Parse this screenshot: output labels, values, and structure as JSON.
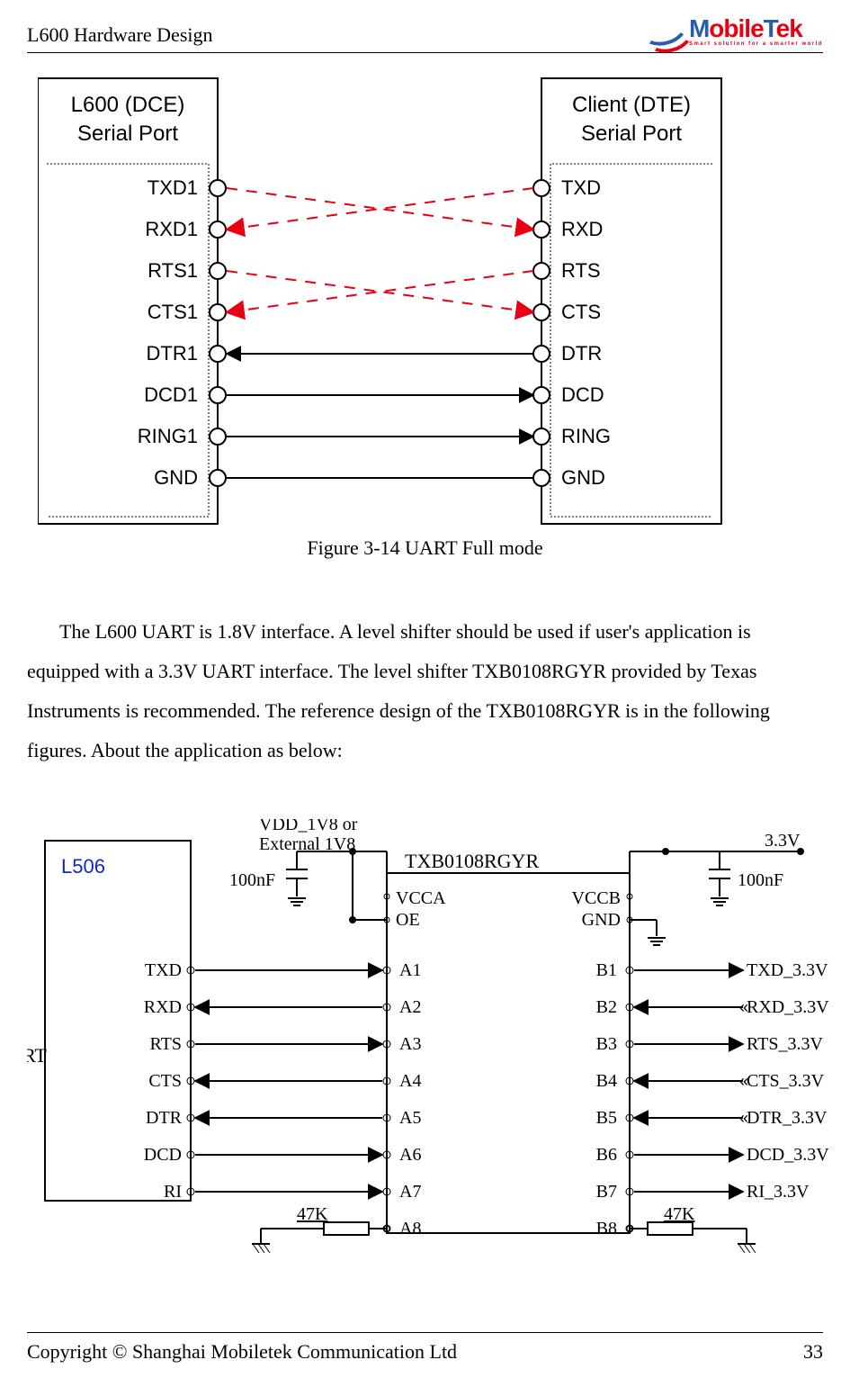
{
  "header": {
    "title": "L600 Hardware Design",
    "logo_main1": "M",
    "logo_main2": "obile",
    "logo_main3": "T",
    "logo_main4": "ek",
    "logo_tag": "Smart solution for a smarter world"
  },
  "footer": {
    "copyright": "Copyright  ©  Shanghai  Mobiletek  Communication  Ltd",
    "page": "33"
  },
  "figure": {
    "caption": "Figure 3-14 UART Full mode"
  },
  "body": {
    "p1": "The L600 UART is 1.8V interface. A level shifter should be used if user's application is equipped with a 3.3V UART interface. The level shifter TXB0108RGYR provided by Texas Instruments is recommended. The reference design of the TXB0108RGYR is in the following figures. About the application as below:"
  },
  "diagram": {
    "left_title": "L600 (DCE)",
    "left_sub": "Serial Port",
    "right_title": "Client (DTE)",
    "right_sub": "Serial Port",
    "left_pins": [
      "TXD1",
      "RXD1",
      "RTS1",
      "CTS1",
      "DTR1",
      "DCD1",
      "RING1",
      "GND"
    ],
    "right_pins": [
      "TXD",
      "RXD",
      "RTS",
      "CTS",
      "DTR",
      "DCD",
      "RING",
      "GND"
    ]
  },
  "image2": {
    "vdd": "VDD_1V8 or\nExternal 1V8",
    "v33": "3.3V",
    "c1": "100nF",
    "c2": "100nF",
    "chip": "TXB0108RGYR",
    "vcca": "VCCA",
    "vccb": "VCCB",
    "oe": "OE",
    "gnd": "GND",
    "module": "L506",
    "uart": "UART",
    "r1": "47K",
    "r2": "47K",
    "a": [
      "A1",
      "A2",
      "A3",
      "A4",
      "A5",
      "A6",
      "A7",
      "A8"
    ],
    "b": [
      "B1",
      "B2",
      "B3",
      "B4",
      "B5",
      "B6",
      "B7",
      "B8"
    ],
    "left": [
      "TXD",
      "RXD",
      "RTS",
      "CTS",
      "DTR",
      "DCD",
      "RI"
    ],
    "right": [
      "TXD_3.3V",
      "RXD_3.3V",
      "RTS_3.3V",
      "CTS_3.3V",
      "DTR_3.3V",
      "DCD_3.3V",
      "RI_3.3V"
    ]
  }
}
